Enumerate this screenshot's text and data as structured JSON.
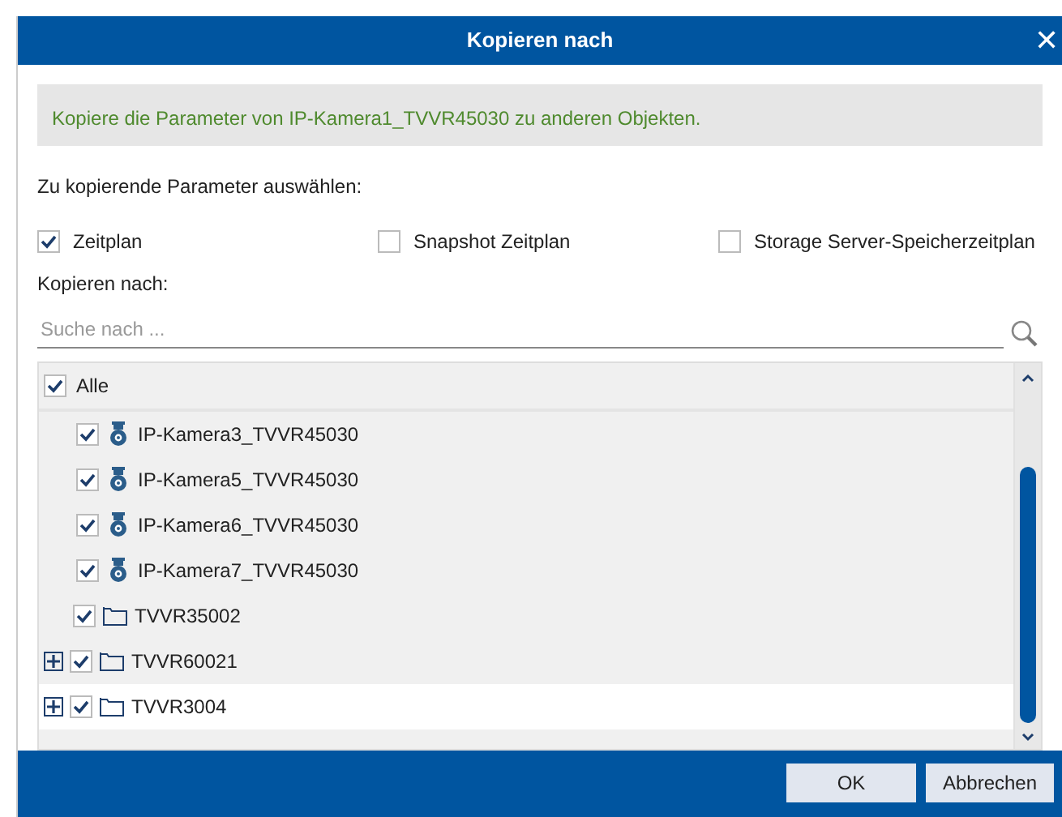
{
  "window": {
    "title": "Kopieren nach",
    "close": "✕"
  },
  "info": "Kopiere die Parameter von IP-Kamera1_TVVR45030 zu anderen Objekten.",
  "params_label": "Zu kopierende Parameter auswählen:",
  "params": [
    {
      "label": "Zeitplan",
      "checked": true
    },
    {
      "label": "Snapshot Zeitplan",
      "checked": false
    },
    {
      "label": "Storage Server-Speicherzeitplan",
      "checked": false
    }
  ],
  "target_label": "Kopieren nach:",
  "search": {
    "placeholder": "Suche nach ..."
  },
  "tree": {
    "all": {
      "label": "Alle",
      "checked": true
    },
    "items": [
      {
        "kind": "hidden",
        "children": [
          {
            "kind": "camera",
            "label": "IP-Kamera3_TVVR45030",
            "checked": true,
            "selected": false
          },
          {
            "kind": "camera",
            "label": "IP-Kamera5_TVVR45030",
            "checked": true,
            "selected": false
          },
          {
            "kind": "camera",
            "label": "IP-Kamera6_TVVR45030",
            "checked": true,
            "selected": false
          },
          {
            "kind": "camera",
            "label": "IP-Kamera7_TVVR45030",
            "checked": true,
            "selected": false
          }
        ]
      },
      {
        "kind": "folder",
        "label": "TVVR35002",
        "checked": true,
        "selected": false,
        "expandable": false
      },
      {
        "kind": "folder",
        "label": "TVVR60021",
        "checked": true,
        "selected": false,
        "expandable": true
      },
      {
        "kind": "folder",
        "label": "TVVR3004",
        "checked": true,
        "selected": true,
        "expandable": true
      }
    ]
  },
  "buttons": [
    "OK",
    "Abbrechen"
  ]
}
